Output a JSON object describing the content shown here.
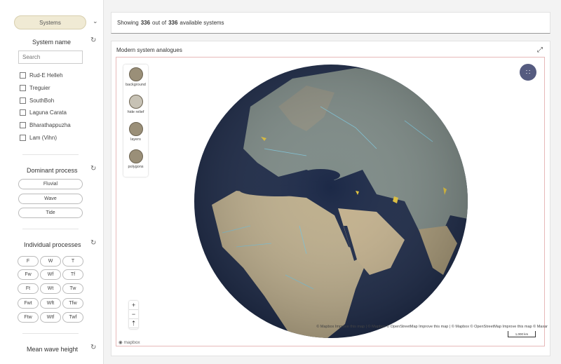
{
  "sidebar": {
    "systems_button": "Systems",
    "system_name_title": "System name",
    "search_placeholder": "Search",
    "systems": [
      "Rud-E Helleh",
      "Treguier",
      "SouthBoh",
      "Laguna Carata",
      "Bharathappuzha",
      "Lam (Vihn)"
    ],
    "dominant_title": "Dominant process",
    "dominant": [
      "Fluvial",
      "Wave",
      "Tide"
    ],
    "individual_title": "Individual processes",
    "individual": [
      "F",
      "W",
      "T",
      "Fw",
      "Wf",
      "Tf",
      "Ft",
      "Wt",
      "Tw",
      "Fwt",
      "Wft",
      "Tfw",
      "Ftw",
      "Wtf",
      "Twf"
    ],
    "wave_title": "Mean wave height"
  },
  "header": {
    "prefix": "Showing",
    "shown": "336",
    "middle": "out of",
    "total": "336",
    "suffix": "available systems"
  },
  "map": {
    "title": "Modern system analogues",
    "tools": [
      "background",
      "hide relief",
      "layers",
      "polygons"
    ],
    "zoom_in": "+",
    "zoom_out": "−",
    "compass": "⇡",
    "scale": "1,000 km",
    "logo": "mapbox",
    "attribution": "© Mapbox  Improve this map | © Mapbox © OpenStreetMap  Improve this map | © Mapbox © OpenStreetMap  Improve this map © Maxar"
  },
  "colors": {
    "accent": "#555b80",
    "pill": "#f0ead4",
    "ocean": "#1d2a4a",
    "land": "#b9ab8a"
  }
}
